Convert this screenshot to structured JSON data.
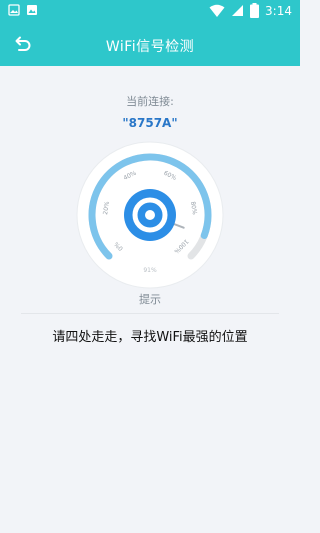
{
  "status_bar": {
    "time": "3:14",
    "battery_level": "3"
  },
  "app_bar": {
    "title": "WiFi信号检测"
  },
  "connection": {
    "label": "当前连接:",
    "ssid": "\"8757A\""
  },
  "gauge": {
    "ticks": [
      "0%",
      "20%",
      "40%",
      "60%",
      "80%",
      "100%"
    ],
    "reading": "91%",
    "value": 91,
    "arc_color": "#7dc4ec",
    "center_color": "#2c8ee6"
  },
  "hint": {
    "title": "提示",
    "text": "请四处走走，寻找WiFi最强的位置"
  }
}
